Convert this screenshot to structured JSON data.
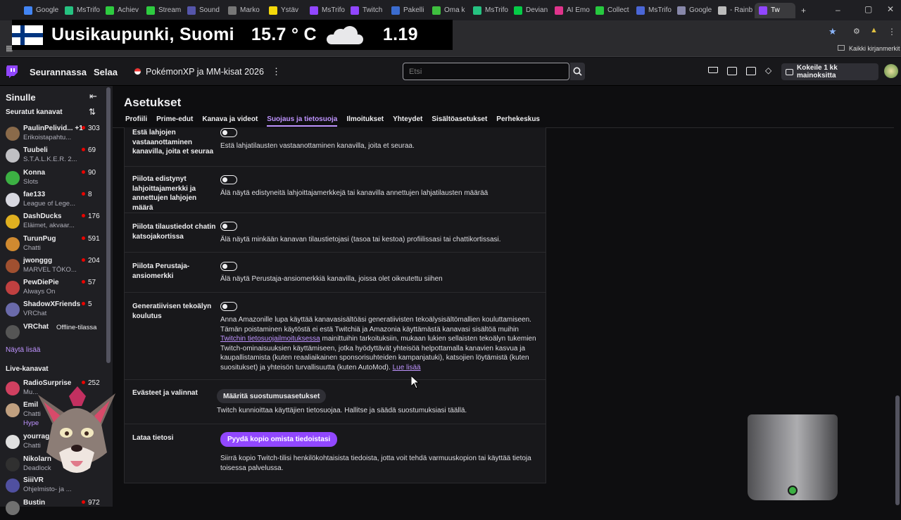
{
  "browser": {
    "tabs": [
      {
        "label": "Google",
        "color": "#4285f4"
      },
      {
        "label": "MsTrifo",
        "color": "#26c281"
      },
      {
        "label": "Achiev",
        "color": "#2ecc40"
      },
      {
        "label": "Stream",
        "color": "#2ecc40"
      },
      {
        "label": "Sound",
        "color": "#5555aa"
      },
      {
        "label": "Marko",
        "color": "#777777"
      },
      {
        "label": "Ystäv",
        "color": "#f5d90a"
      },
      {
        "label": "MsTrifo",
        "color": "#9146ff"
      },
      {
        "label": "Twitch",
        "color": "#9146ff"
      },
      {
        "label": "Pakelli",
        "color": "#3b6ccf"
      },
      {
        "label": "Oma k",
        "color": "#3fbf3f"
      },
      {
        "label": "MsTrifo",
        "color": "#26c281"
      },
      {
        "label": "Devian",
        "color": "#05cc47"
      },
      {
        "label": "AI Emo",
        "color": "#e0348c"
      },
      {
        "label": "Collect",
        "color": "#27c93f"
      },
      {
        "label": "MsTrifo",
        "color": "#4a66d6"
      },
      {
        "label": "Google",
        "color": "#8888aa"
      },
      {
        "label": "- Rainb",
        "color": "#bbbbbb"
      },
      {
        "label": "Tw",
        "color": "#9146ff",
        "active": true
      }
    ],
    "new_tab": "+",
    "bookmarks_label": "Kaikki kirjanmerkit"
  },
  "overlay": {
    "city": "Uusikaupunki, Suomi",
    "temp": "15.7 ° C",
    "value": "1.19"
  },
  "nav": {
    "following": "Seurannassa",
    "browse": "Selaa",
    "channel_title": "PokémonXP ja MM-kisat 2026",
    "more": "⋮",
    "search_placeholder": "Etsi",
    "promo": "Kokeile 1 kk mainoksitta"
  },
  "sidebar": {
    "for_you": "Sinulle",
    "followed": "Seuratut kanavat",
    "show_more": "Näytä lisää",
    "live_channels": "Live-kanavat",
    "followed_channels": [
      {
        "name": "PaulinPelivid... +1",
        "game": "Erikoistapahtu...",
        "viewers": "303",
        "color": "#8a6a4a"
      },
      {
        "name": "Tuubeli",
        "game": "S.T.A.L.K.E.R. 2...",
        "viewers": "69",
        "color": "#c0c0c4"
      },
      {
        "name": "Konna",
        "game": "Slots",
        "viewers": "90",
        "color": "#3cb043"
      },
      {
        "name": "fae133",
        "game": "League of Lege...",
        "viewers": "8",
        "color": "#d8d8e0"
      },
      {
        "name": "DashDucks",
        "game": "Eläimet, akvaar...",
        "viewers": "176",
        "color": "#e0b020"
      },
      {
        "name": "TurunPug",
        "game": "Chatti",
        "viewers": "591",
        "color": "#d08a30"
      },
      {
        "name": "jwonggg",
        "game": "MARVEL TŌKO...",
        "viewers": "204",
        "color": "#a05030"
      },
      {
        "name": "PewDiePie",
        "game": "Always On",
        "viewers": "57",
        "color": "#c04040"
      },
      {
        "name": "ShadowXFriends",
        "game": "VRChat",
        "viewers": "5",
        "color": "#6a6aaa"
      },
      {
        "name": "VRChat",
        "game": "",
        "offline": "Offline-tilassa",
        "color": "#555555"
      }
    ],
    "live": [
      {
        "name": "RadioSurprise",
        "game": "Mu...",
        "viewers": "252",
        "color": "#d04060"
      },
      {
        "name": "Emil",
        "game": "Chatti",
        "sub": "Hype",
        "color": "#c0a080"
      },
      {
        "name": "yourragee",
        "game": "Chatti",
        "color": "#e0e0e0"
      },
      {
        "name": "Nikolarn",
        "game": "Deadlock",
        "color": "#303030"
      },
      {
        "name": "SiiiVR",
        "game": "Ohjelmisto- ja ...",
        "color": "#5050a0"
      },
      {
        "name": "Bustin",
        "game": "",
        "viewers": "972",
        "color": "#707070"
      }
    ]
  },
  "settings": {
    "title": "Asetukset",
    "tabs": [
      "Profiili",
      "Prime-edut",
      "Kanava ja videot",
      "Suojaus ja tietosuoja",
      "Ilmoitukset",
      "Yhteydet",
      "Sisältöasetukset",
      "Perhekeskus"
    ],
    "active_tab": "Suojaus ja tietosuoja",
    "rows": {
      "gifts": {
        "label": "Estä lahjojen vastaanottaminen kanavilla, joita et seuraa",
        "desc": "Estä lahjatilausten vastaanottaminen kanavilla, joita et seuraa."
      },
      "leaderboard": {
        "label": "Piilota edistynyt lahjoittajamerkki ja annettujen lahjojen määrä",
        "desc": "Älä näytä edistyneitä lahjoittajamerkkejä tai kanavilla annettujen lahjatilausten määrää"
      },
      "subinfo": {
        "label": "Piilota tilaustiedot chatin katsojakortissa",
        "desc": "Älä näytä minkään kanavan tilaustietojasi (tasoa tai kestoa) profiilissasi tai chattikortissasi."
      },
      "founder": {
        "label": "Piilota Perustaja-ansiomerkki",
        "desc": "Älä näytä Perustaja-ansiomerkkiä kanavilla, joissa olet oikeutettu siihen"
      },
      "ai": {
        "label": "Generatiivisen tekoälyn koulutus",
        "desc_start": "Anna Amazonille lupa käyttää kanavasisältöäsi generatiivisten tekoälysisältömallien kouluttamiseen. Tämän poistaminen käytöstä ei estä Twitchiä ja Amazonia käyttämästä kanavasi sisältöä muihin ",
        "desc_link": "Twitchin tietosuojailmoituksessa",
        "desc_end": " mainittuihin tarkoituksiin, mukaan lukien sellaisten tekoälyn tukemien Twitch-ominaisuuksien käyttämiseen, jotka hyödyttävät yhteisöä helpottamalla kanavien kasvua ja kaupallistamista (kuten reaaliaikainen sponsorisuhteiden kampanjatuki), katsojien löytämistä (kuten suositukset) ja yhteisön turvallisuutta (kuten AutoMod). ",
        "read_more": "Lue lisää"
      },
      "consent": {
        "label": "Evästeet ja valinnat",
        "button": "Määritä suostumusasetukset",
        "desc": "Twitch kunnioittaa käyttäjien tietosuojaa. Hallitse ja säädä suostumuksiasi täällä."
      },
      "download": {
        "label": "Lataa tietosi",
        "button": "Pyydä kopio omista tiedoistasi",
        "desc": "Siirrä kopio Twitch-tilisi henkilökohtaisista tiedoista, jotta voit tehdä varmuuskopion tai käyttää tietoja toisessa palvelussa."
      }
    }
  },
  "colors": {
    "accent": "#9147ff",
    "link": "#bf94ff",
    "live_dot": "#eb0400"
  }
}
